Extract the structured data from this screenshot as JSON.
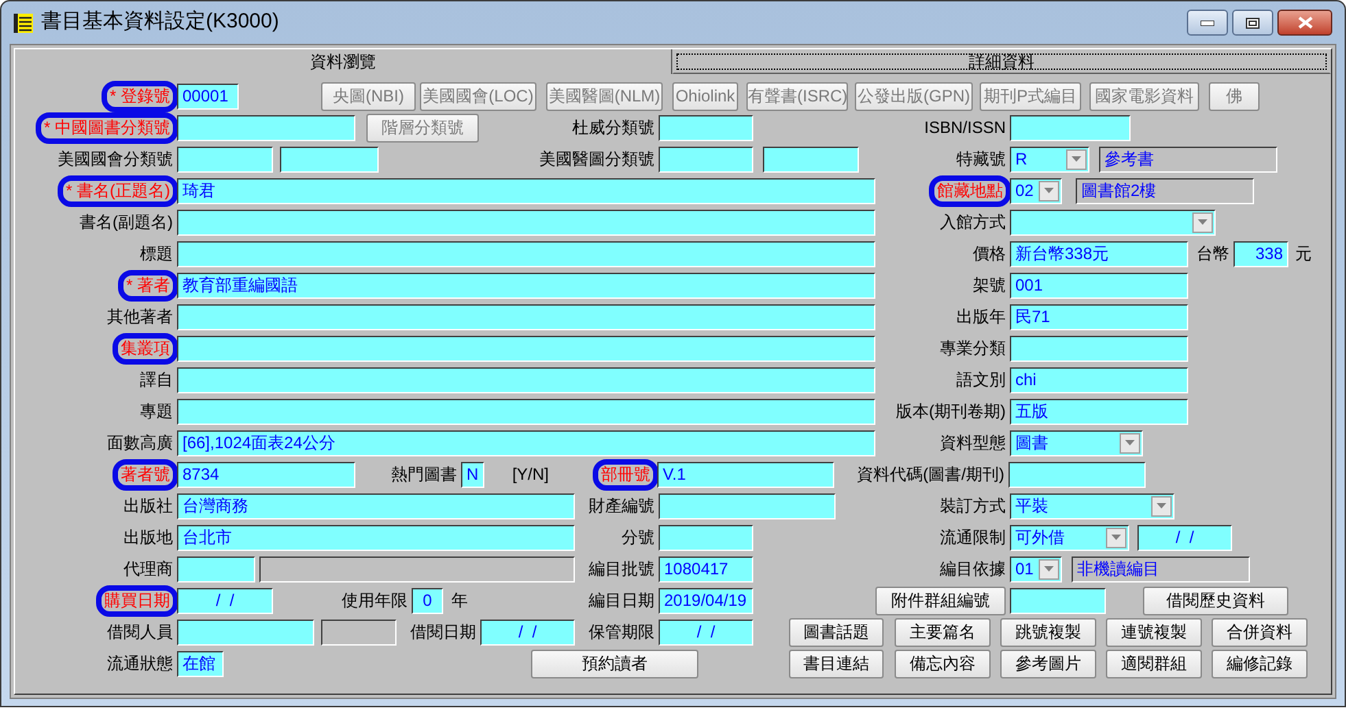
{
  "window": {
    "title": "書目基本資料設定(K3000)"
  },
  "tabs": [
    {
      "label": "資料瀏覽",
      "selected": true
    },
    {
      "label": "詳細資料",
      "selected": false
    }
  ],
  "rows": [
    {
      "items": [
        {
          "kind": "label",
          "text": "* 登錄號",
          "alert": true,
          "circled": true
        },
        {
          "kind": "field",
          "value": "00001",
          "readonly": false
        },
        {
          "kind": "button",
          "label": "央圖(NBI)",
          "disabled": true
        },
        {
          "kind": "button",
          "label": "美國國會(LOC)",
          "disabled": true
        },
        {
          "kind": "button",
          "label": "美國醫圖(NLM)",
          "disabled": true
        },
        {
          "kind": "button",
          "label": "Ohiolink",
          "disabled": true
        },
        {
          "kind": "button",
          "label": "有聲書(ISRC)",
          "disabled": true
        },
        {
          "kind": "button",
          "label": "公發出版(GPN)",
          "disabled": true
        },
        {
          "kind": "button",
          "label": "期刊P式編目",
          "disabled": true
        },
        {
          "kind": "button",
          "label": "國家電影資料",
          "disabled": true
        },
        {
          "kind": "button",
          "label": "佛",
          "disabled": true
        }
      ]
    },
    {
      "items": [
        {
          "kind": "label",
          "text": "* 中國圖書分類號",
          "alert": true,
          "circled": true
        },
        {
          "kind": "field",
          "readonly": false
        },
        {
          "kind": "button",
          "label": "階層分類號",
          "disabled": true
        },
        {
          "kind": "label",
          "text": "杜威分類號",
          "alert": false,
          "circled": false
        },
        {
          "kind": "field",
          "readonly": false
        },
        {
          "kind": "label",
          "text": "ISBN/ISSN",
          "alert": false,
          "circled": false
        },
        {
          "kind": "field",
          "readonly": false
        }
      ]
    },
    {
      "items": [
        {
          "kind": "label",
          "text": "美國國會分類號",
          "alert": false,
          "circled": false
        },
        {
          "kind": "field",
          "readonly": false
        },
        {
          "kind": "field",
          "readonly": false
        },
        {
          "kind": "label",
          "text": "美國醫圖分類號",
          "alert": false,
          "circled": false
        },
        {
          "kind": "field",
          "readonly": false
        },
        {
          "kind": "field",
          "readonly": false
        },
        {
          "kind": "label",
          "text": "特藏號",
          "alert": false,
          "circled": false
        },
        {
          "kind": "dropdown",
          "value": "R"
        },
        {
          "kind": "field",
          "value": "參考書",
          "readonly": true
        }
      ]
    },
    {
      "items": [
        {
          "kind": "label",
          "text": "* 書名(正題名)",
          "alert": true,
          "circled": true
        },
        {
          "kind": "field",
          "value": "琦君",
          "readonly": false
        },
        {
          "kind": "label",
          "text": "館藏地點",
          "alert": true,
          "circled": true
        },
        {
          "kind": "dropdown",
          "value": "02"
        },
        {
          "kind": "field",
          "value": "圖書館2樓",
          "readonly": true
        }
      ]
    },
    {
      "items": [
        {
          "kind": "label",
          "text": "書名(副題名)",
          "alert": false,
          "circled": false
        },
        {
          "kind": "field",
          "readonly": false
        },
        {
          "kind": "label",
          "text": "入館方式",
          "alert": false,
          "circled": false
        },
        {
          "kind": "dropdown"
        }
      ]
    },
    {
      "items": [
        {
          "kind": "label",
          "text": "標題",
          "alert": false,
          "circled": false
        },
        {
          "kind": "field",
          "readonly": false
        },
        {
          "kind": "label",
          "text": "價格",
          "alert": false,
          "circled": false
        },
        {
          "kind": "field",
          "value": "新台幣338元",
          "readonly": false
        },
        {
          "kind": "label",
          "text": "台幣",
          "alert": false,
          "circled": false
        },
        {
          "kind": "field",
          "value": "338",
          "readonly": false
        },
        {
          "kind": "label",
          "text": "元",
          "alert": false,
          "circled": false
        }
      ]
    },
    {
      "items": [
        {
          "kind": "label",
          "text": "* 著者",
          "alert": true,
          "circled": true
        },
        {
          "kind": "field",
          "value": "教育部重編國語",
          "readonly": false
        },
        {
          "kind": "label",
          "text": "架號",
          "alert": false,
          "circled": false
        },
        {
          "kind": "field",
          "value": "001",
          "readonly": false
        }
      ]
    },
    {
      "items": [
        {
          "kind": "label",
          "text": "其他著者",
          "alert": false,
          "circled": false
        },
        {
          "kind": "field",
          "readonly": false
        },
        {
          "kind": "label",
          "text": "出版年",
          "alert": false,
          "circled": false
        },
        {
          "kind": "field",
          "value": "民71",
          "readonly": false
        }
      ]
    },
    {
      "items": [
        {
          "kind": "label",
          "text": "集叢項",
          "alert": true,
          "circled": true
        },
        {
          "kind": "field",
          "readonly": false
        },
        {
          "kind": "label",
          "text": "專業分類",
          "alert": false,
          "circled": false
        },
        {
          "kind": "field",
          "readonly": false
        }
      ]
    },
    {
      "items": [
        {
          "kind": "label",
          "text": "譯自",
          "alert": false,
          "circled": false
        },
        {
          "kind": "field",
          "readonly": false
        },
        {
          "kind": "label",
          "text": "語文別",
          "alert": false,
          "circled": false
        },
        {
          "kind": "field",
          "value": "chi",
          "readonly": false
        }
      ]
    },
    {
      "items": [
        {
          "kind": "label",
          "text": "專題",
          "alert": false,
          "circled": false
        },
        {
          "kind": "field",
          "readonly": false
        },
        {
          "kind": "label",
          "text": "版本(期刊卷期)",
          "alert": false,
          "circled": false
        },
        {
          "kind": "field",
          "value": "五版",
          "readonly": false
        }
      ]
    },
    {
      "items": [
        {
          "kind": "label",
          "text": "面數高廣",
          "alert": false,
          "circled": false
        },
        {
          "kind": "field",
          "value": "[66],1024面表24公分",
          "readonly": false
        },
        {
          "kind": "label",
          "text": "資料型態",
          "alert": false,
          "circled": false
        },
        {
          "kind": "dropdown",
          "value": "圖書"
        }
      ]
    },
    {
      "items": [
        {
          "kind": "label",
          "text": "著者號",
          "alert": true,
          "circled": true
        },
        {
          "kind": "field",
          "value": "8734",
          "readonly": false
        },
        {
          "kind": "label",
          "text": "熱門圖書",
          "alert": false,
          "circled": false
        },
        {
          "kind": "field",
          "value": "N",
          "readonly": false
        },
        {
          "kind": "label",
          "text": "[Y/N]",
          "alert": false,
          "circled": false
        },
        {
          "kind": "label",
          "text": "部冊號",
          "alert": true,
          "circled": true
        },
        {
          "kind": "field",
          "value": "V.1",
          "readonly": false
        },
        {
          "kind": "label",
          "text": "資料代碼(圖書/期刊)",
          "alert": false,
          "circled": false
        },
        {
          "kind": "field",
          "readonly": false
        }
      ]
    },
    {
      "items": [
        {
          "kind": "label",
          "text": "出版社",
          "alert": false,
          "circled": false
        },
        {
          "kind": "field",
          "value": "台灣商務",
          "readonly": false
        },
        {
          "kind": "label",
          "text": "財產編號",
          "alert": false,
          "circled": false
        },
        {
          "kind": "field",
          "readonly": false
        },
        {
          "kind": "label",
          "text": "裝訂方式",
          "alert": false,
          "circled": false
        },
        {
          "kind": "dropdown",
          "value": "平裝"
        }
      ]
    },
    {
      "items": [
        {
          "kind": "label",
          "text": "出版地",
          "alert": false,
          "circled": false
        },
        {
          "kind": "field",
          "value": "台北市",
          "readonly": false
        },
        {
          "kind": "label",
          "text": "分號",
          "alert": false,
          "circled": false
        },
        {
          "kind": "field",
          "readonly": false
        },
        {
          "kind": "label",
          "text": "流通限制",
          "alert": false,
          "circled": false
        },
        {
          "kind": "dropdown",
          "value": "可外借"
        },
        {
          "kind": "field",
          "value": "/  /",
          "readonly": false
        }
      ]
    },
    {
      "items": [
        {
          "kind": "label",
          "text": "代理商",
          "alert": false,
          "circled": false
        },
        {
          "kind": "field",
          "readonly": false
        },
        {
          "kind": "field",
          "readonly": true
        },
        {
          "kind": "label",
          "text": "編目批號",
          "alert": false,
          "circled": false
        },
        {
          "kind": "field",
          "value": "1080417",
          "readonly": false
        },
        {
          "kind": "label",
          "text": "編目依據",
          "alert": false,
          "circled": false
        },
        {
          "kind": "dropdown",
          "value": "01"
        },
        {
          "kind": "field",
          "value": "非機讀編目",
          "readonly": true
        }
      ]
    },
    {
      "items": [
        {
          "kind": "label",
          "text": "購買日期",
          "alert": true,
          "circled": true
        },
        {
          "kind": "field",
          "value": "/  /",
          "readonly": false
        },
        {
          "kind": "label",
          "text": "使用年限",
          "alert": false,
          "circled": false
        },
        {
          "kind": "field",
          "value": "0",
          "readonly": false
        },
        {
          "kind": "label",
          "text": "年",
          "alert": false,
          "circled": false
        },
        {
          "kind": "label",
          "text": "編目日期",
          "alert": false,
          "circled": false
        },
        {
          "kind": "field",
          "value": "2019/04/19",
          "readonly": false
        },
        {
          "kind": "button",
          "label": "附件群組編號",
          "disabled": false
        },
        {
          "kind": "field",
          "readonly": false
        },
        {
          "kind": "button",
          "label": "借閱歷史資料",
          "disabled": false
        }
      ]
    },
    {
      "items": [
        {
          "kind": "label",
          "text": "借閱人員",
          "alert": false,
          "circled": false
        },
        {
          "kind": "field",
          "readonly": false
        },
        {
          "kind": "field",
          "readonly": true
        },
        {
          "kind": "label",
          "text": "借閱日期",
          "alert": false,
          "circled": false
        },
        {
          "kind": "field",
          "value": "/  /",
          "readonly": false
        },
        {
          "kind": "label",
          "text": "保管期限",
          "alert": false,
          "circled": false
        },
        {
          "kind": "field",
          "value": "/  /",
          "readonly": false
        },
        {
          "kind": "button",
          "label": "圖書話題",
          "disabled": false
        },
        {
          "kind": "button",
          "label": "主要篇名",
          "disabled": false
        },
        {
          "kind": "button",
          "label": "跳號複製",
          "disabled": false
        },
        {
          "kind": "button",
          "label": "連號複製",
          "disabled": false
        },
        {
          "kind": "button",
          "label": "合併資料",
          "disabled": false
        }
      ]
    },
    {
      "items": [
        {
          "kind": "label",
          "text": "流通狀態",
          "alert": false,
          "circled": false
        },
        {
          "kind": "field",
          "value": "在館",
          "readonly": false
        },
        {
          "kind": "button",
          "label": "預約讀者",
          "disabled": false
        },
        {
          "kind": "button",
          "label": "書目連結",
          "disabled": false
        },
        {
          "kind": "button",
          "label": "備忘內容",
          "disabled": false
        },
        {
          "kind": "button",
          "label": "參考圖片",
          "disabled": false
        },
        {
          "kind": "button",
          "label": "適閱群組",
          "disabled": false
        },
        {
          "kind": "button",
          "label": "編修記錄",
          "disabled": false
        }
      ]
    }
  ]
}
